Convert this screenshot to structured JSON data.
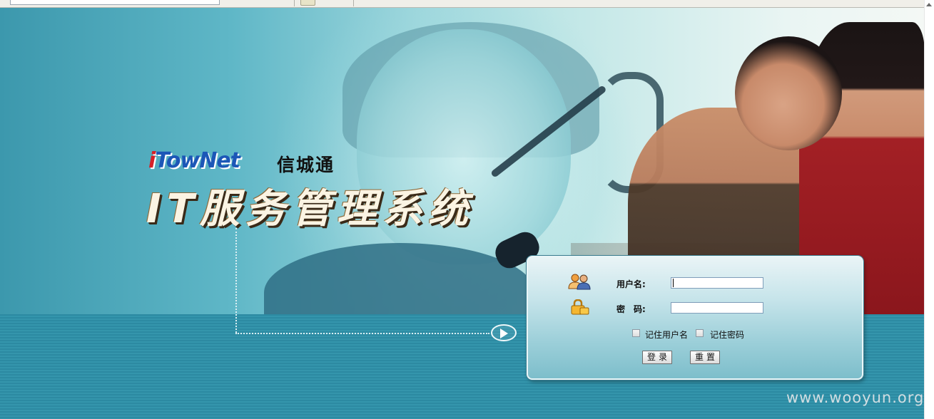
{
  "browser": {
    "url_field": ""
  },
  "banner": {
    "brand_i": "i",
    "brand_rest": "TowNet",
    "brand_cn": "信城通",
    "system_title": "IT服务管理系统"
  },
  "login": {
    "username_label": "用户名:",
    "password_label": "密　码:",
    "username_value": "",
    "password_value": "",
    "remember_username_label": "记住用户名",
    "remember_password_label": "记住密码",
    "remember_username_checked": false,
    "remember_password_checked": false,
    "login_button": "登录",
    "reset_button": "重置"
  },
  "watermark": "www.wooyun.org",
  "colors": {
    "brand_blue": "#1c57b7",
    "brand_red": "#d62128",
    "band": "#2c8aa2",
    "panel": "#9ccfd9"
  }
}
